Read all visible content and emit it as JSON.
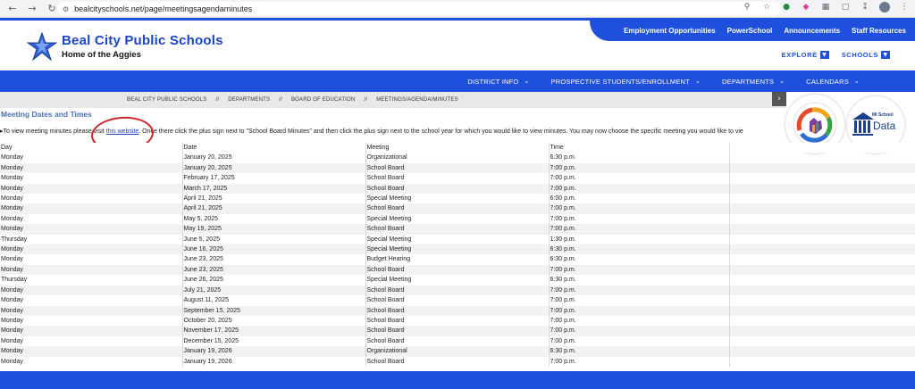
{
  "browser": {
    "url": "bealcityschools.net/page/meetingsagendaminutes"
  },
  "header": {
    "school_name": "Beal City Public Schools",
    "tagline": "Home of the Aggies",
    "utility_links": [
      "Employment Opportunities",
      "PowerSchool",
      "Announcements",
      "Staff Resources"
    ],
    "explore_label": "EXPLORE",
    "schools_label": "SCHOOLS"
  },
  "nav": {
    "items": [
      "DISTRICT INFO",
      "PROSPECTIVE STUDENTS/ENROLLMENT",
      "DEPARTMENTS",
      "CALENDARS"
    ]
  },
  "breadcrumb": {
    "items": [
      "BEAL CITY PUBLIC SCHOOLS",
      "DEPARTMENTS",
      "BOARD OF EDUCATION",
      "MEETINGS/AGENDA/MINUTES"
    ],
    "separator": "//"
  },
  "content": {
    "section_title": "Meeting Dates and Times",
    "instructions_before": "To view meeting minutes please visit ",
    "instructions_link": "this website",
    "instructions_after": ". Once there click the plus sign next to \"School Board Minutes\" and then click the plus sign next to the school year for which you would like to view minutes.    You may now choose the specific meeting you would like to vie"
  },
  "badges": {
    "data_small": "MI School",
    "data_big": "Data"
  },
  "table": {
    "headers": [
      "Day",
      "Date",
      "Meeting",
      "Time",
      ""
    ],
    "rows": [
      [
        "Monday",
        "January 20, 2025",
        "Organizational",
        "6:30 p.m."
      ],
      [
        "Monday",
        "January 20, 2025",
        "School Board",
        "7:00 p.m."
      ],
      [
        "Monday",
        "February 17, 2025",
        "School Board",
        "7:00 p.m."
      ],
      [
        "Monday",
        "March 17, 2025",
        "School Board",
        "7:00 p.m."
      ],
      [
        "Monday",
        "April 21, 2025",
        "Special Meeting",
        "6:00 p.m."
      ],
      [
        "Monday",
        "April 21, 2025",
        "School Board",
        "7:00 p.m."
      ],
      [
        "Monday",
        "May 5, 2025",
        "Special Meeting",
        "7:00 p.m."
      ],
      [
        "Monday",
        "May 19, 2025",
        "School Board",
        "7:00 p.m."
      ],
      [
        "Thursday",
        "June 5, 2025",
        "Special Meeting",
        "1:30 p.m."
      ],
      [
        "Monday",
        "June 16, 2025",
        "Special Meeting",
        "6:30 p.m."
      ],
      [
        "Monday",
        "June 23, 2025",
        "Budget Hearing",
        "6:30 p.m."
      ],
      [
        "Monday",
        "June 23, 2025",
        "School Board",
        "7:00 p.m."
      ],
      [
        "Thursday",
        "June 26, 2025",
        "Special Meeting",
        "6:30 p.m."
      ],
      [
        "Monday",
        "July 21, 2025",
        "School Board",
        "7:00 p.m."
      ],
      [
        "Monday",
        "August 11, 2025",
        "School Board",
        "7:00 p.m."
      ],
      [
        "Monday",
        "September 15, 2025",
        "School Board",
        "7:00 p.m."
      ],
      [
        "Monday",
        "October 20, 2025",
        "School Board",
        "7:00 p.m."
      ],
      [
        "Monday",
        "November 17, 2025",
        "School Board",
        "7:00 p.m."
      ],
      [
        "Monday",
        "December 15, 2025",
        "School Board",
        "7:00 p.m."
      ],
      [
        "Monday",
        "January 19, 2026",
        "Organizational",
        "6:30 p.m."
      ],
      [
        "Monday",
        "January 19, 2026",
        "School Board",
        "7:00 p.m."
      ]
    ]
  },
  "colors": {
    "brand_blue": "#1f4fdd",
    "title_blue": "#4a6fb5",
    "annotation_red": "#d62525"
  }
}
